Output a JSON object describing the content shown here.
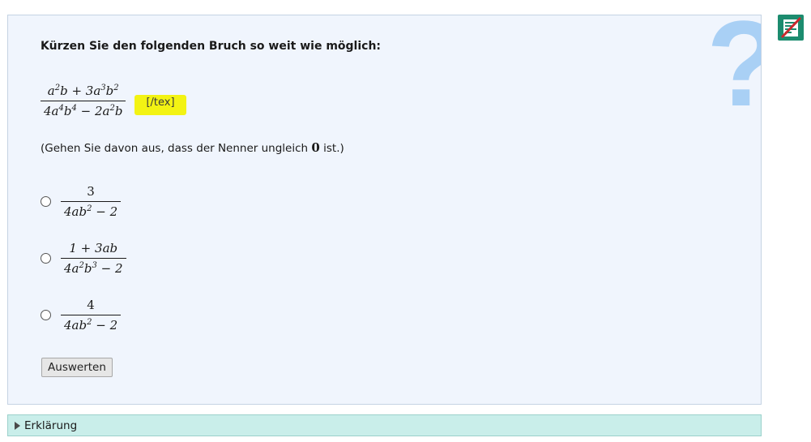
{
  "prompt": "Kürzen Sie den folgenden Bruch so weit wie möglich:",
  "tex_marker": "[/tex]",
  "note": {
    "before": "(Gehen Sie davon aus, dass der Nenner ungleich ",
    "value": "0",
    "after": " ist.)"
  },
  "submit_label": "Auswerten",
  "explanation_label": "Erklärung",
  "colors": {
    "accent": "#a9d0f5",
    "explain_bg": "#c9eeea",
    "marker": "#f3f313",
    "icon_green": "#1c8c6f",
    "icon_red": "#c9282d"
  },
  "icons": {
    "help": "question-mark-icon",
    "corner": "notes-disabled-icon",
    "expand": "triangle-right-icon"
  }
}
